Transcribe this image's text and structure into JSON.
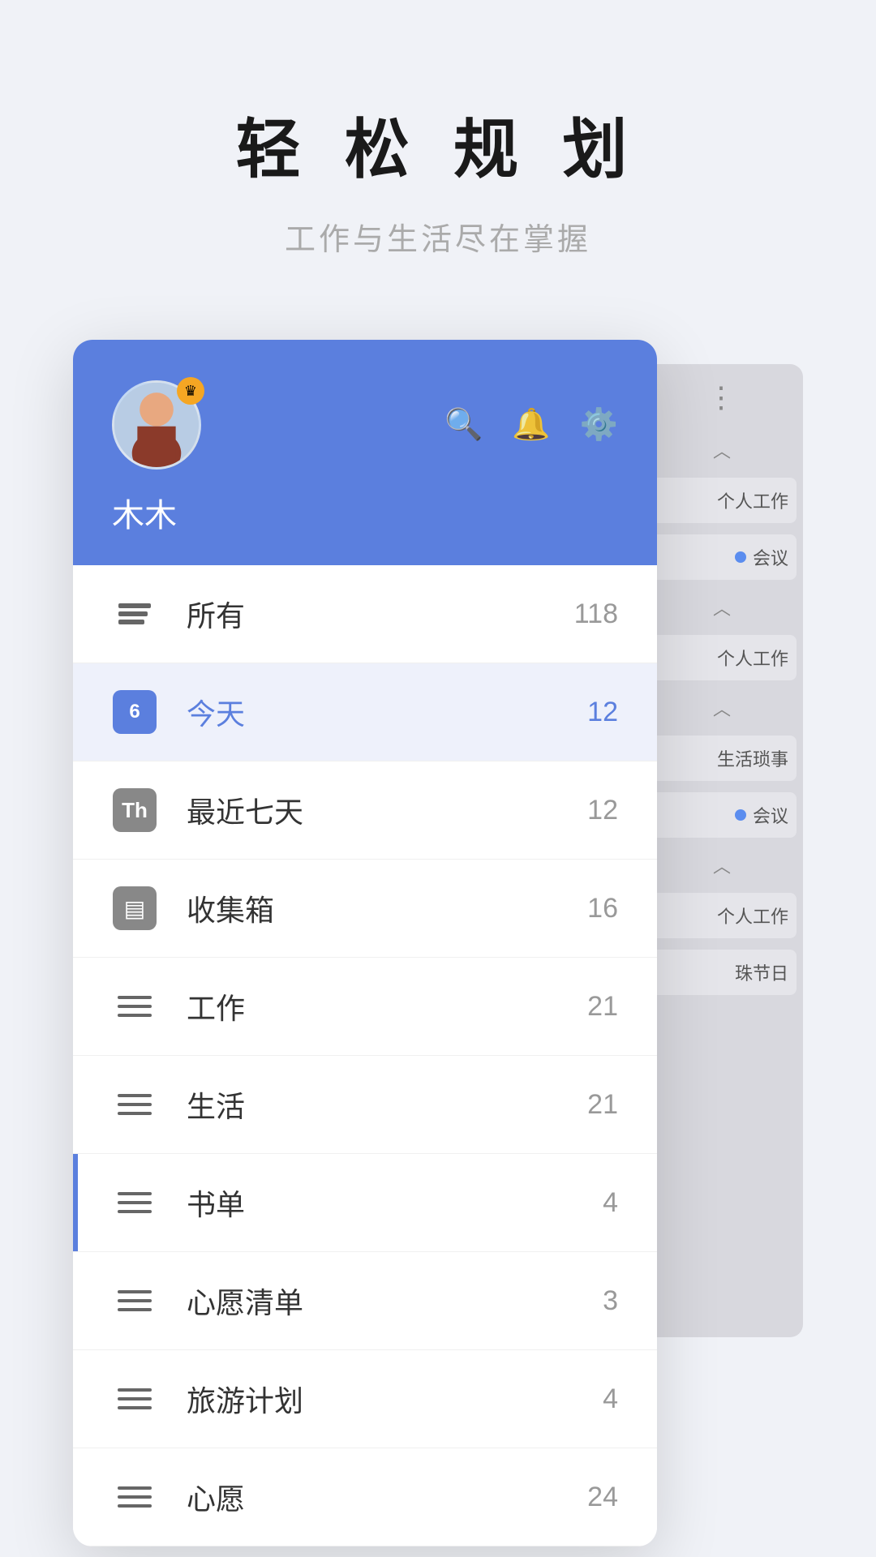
{
  "header": {
    "title": "轻 松 规 划",
    "subtitle": "工作与生活尽在掌握"
  },
  "user": {
    "name": "木木",
    "crown": "👑"
  },
  "icons": {
    "search": "🔍",
    "bell": "🔔",
    "gear": "⚙️",
    "more": "⋮"
  },
  "menu": [
    {
      "id": "all",
      "label": "所有",
      "count": 118,
      "active": false
    },
    {
      "id": "today",
      "label": "今天",
      "count": 12,
      "active": true
    },
    {
      "id": "week",
      "label": "最近七天",
      "count": 12,
      "active": false
    },
    {
      "id": "inbox",
      "label": "收集箱",
      "count": 16,
      "active": false
    },
    {
      "id": "work",
      "label": "工作",
      "count": 21,
      "active": false
    },
    {
      "id": "life",
      "label": "生活",
      "count": 21,
      "active": false
    },
    {
      "id": "books",
      "label": "书单",
      "count": 4,
      "active": false
    },
    {
      "id": "wishes",
      "label": "心愿清单",
      "count": 3,
      "active": false
    },
    {
      "id": "travel",
      "label": "旅游计划",
      "count": 4,
      "active": false
    },
    {
      "id": "dream",
      "label": "心愿",
      "count": 24,
      "active": false
    }
  ],
  "bgPanel": {
    "items": [
      "个人工作",
      "会议",
      "个人工作",
      "生活琐事",
      "会议",
      "个人工作",
      "珠节日"
    ]
  }
}
